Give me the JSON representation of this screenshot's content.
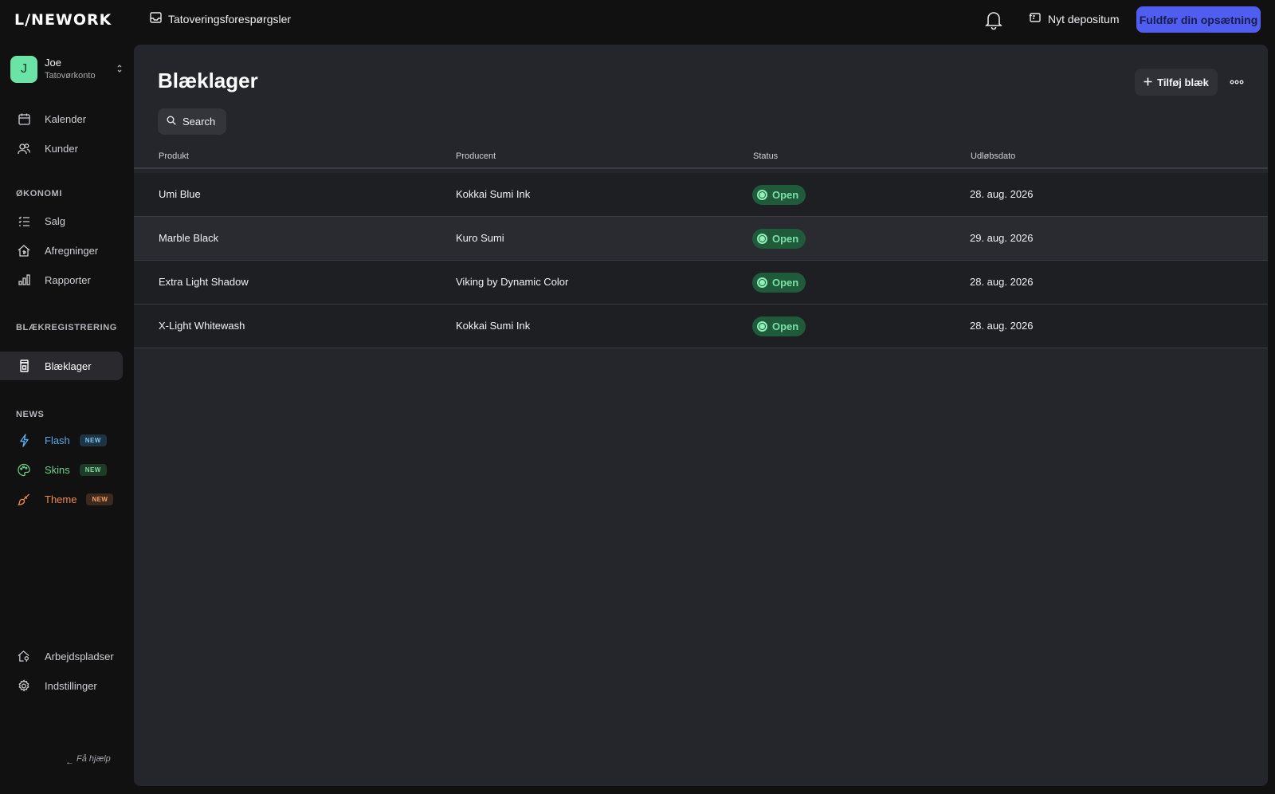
{
  "app": {
    "logo": "L/NEWORK"
  },
  "topbar": {
    "requests_label": "Tatoveringsforespørgsler",
    "deposit_label": "Nyt depositum",
    "cta_label": "Fuldfør din opsætning"
  },
  "account": {
    "initial": "J",
    "name": "Joe",
    "type": "Tatovørkonto"
  },
  "sidebar": {
    "primary": [
      {
        "label": "Kalender",
        "icon": "calendar-icon"
      },
      {
        "label": "Kunder",
        "icon": "users-icon"
      }
    ],
    "economy_title": "ØKONOMI",
    "economy": [
      {
        "label": "Salg",
        "icon": "list-icon"
      },
      {
        "label": "Afregninger",
        "icon": "payout-icon"
      },
      {
        "label": "Rapporter",
        "icon": "bar-chart-icon"
      }
    ],
    "ink_title": "BLÆKREGISTRERING",
    "ink": [
      {
        "label": "Blæklager",
        "icon": "ink-bottle-icon",
        "active": true
      }
    ],
    "news_title": "NEWS",
    "news": [
      {
        "label": "Flash",
        "badge": "NEW",
        "icon": "lightning-icon",
        "color": "#5aa9e6",
        "badge_bg": "#1d3442",
        "badge_color": "#7cc4f0"
      },
      {
        "label": "Skins",
        "badge": "NEW",
        "icon": "palette-icon",
        "color": "#6bd48a",
        "badge_bg": "#1f3a28",
        "badge_color": "#7fdc98"
      },
      {
        "label": "Theme",
        "badge": "NEW",
        "icon": "brush-icon",
        "color": "#f0894a",
        "badge_bg": "#3d2a1e",
        "badge_color": "#f59c63"
      }
    ],
    "bottom": [
      {
        "label": "Arbejdspladser",
        "icon": "workplace-icon"
      },
      {
        "label": "Indstillinger",
        "icon": "gear-icon"
      }
    ],
    "help_label": "Få hjælp"
  },
  "main": {
    "title": "Blæklager",
    "add_label": "Tilføj blæk",
    "search_placeholder": "Search",
    "columns": [
      "Produkt",
      "Producent",
      "Status",
      "Udløbsdato"
    ],
    "rows": [
      {
        "product": "Umi Blue",
        "maker": "Kokkai Sumi Ink",
        "status": "Open",
        "expiry": "28. aug. 2026"
      },
      {
        "product": "Marble Black",
        "maker": "Kuro Sumi",
        "status": "Open",
        "expiry": "29. aug. 2026"
      },
      {
        "product": "Extra Light Shadow",
        "maker": "Viking by Dynamic Color",
        "status": "Open",
        "expiry": "28. aug. 2026"
      },
      {
        "product": "X-Light Whitewash",
        "maker": "Kokkai Sumi Ink",
        "status": "Open",
        "expiry": "28. aug. 2026"
      }
    ]
  }
}
